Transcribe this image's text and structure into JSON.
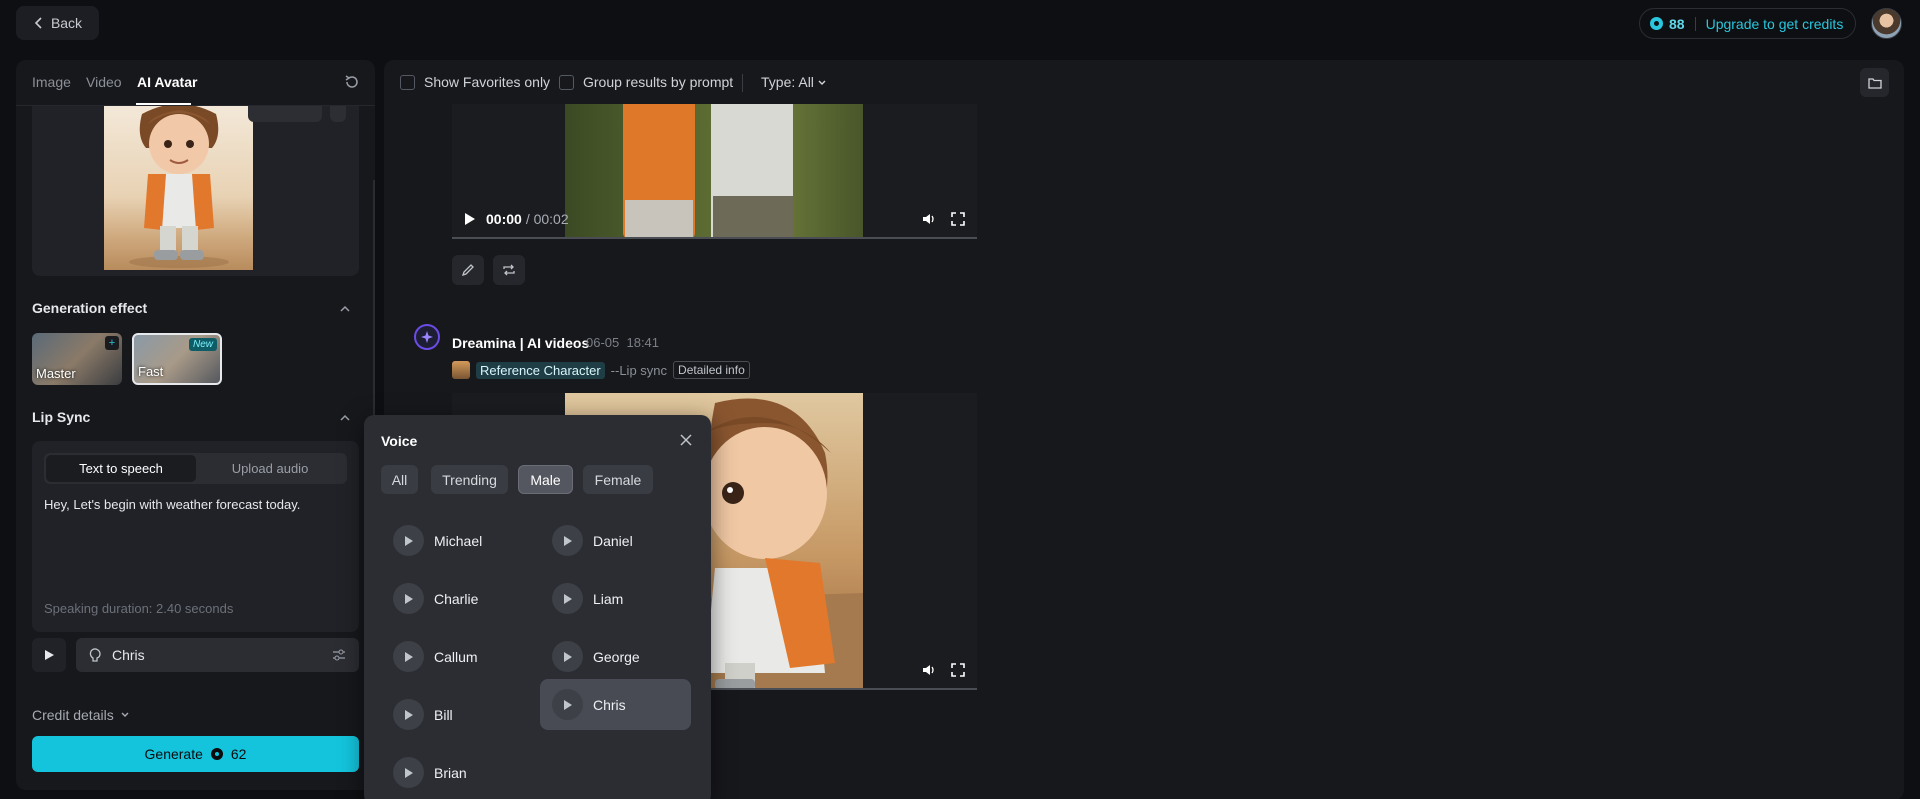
{
  "header": {
    "back_label": "Back",
    "credits": "88",
    "upgrade_label": "Upgrade to get credits"
  },
  "left": {
    "tabs": [
      {
        "label": "Image"
      },
      {
        "label": "Video"
      },
      {
        "label": "AI Avatar"
      }
    ],
    "generation_effect": {
      "title": "Generation effect",
      "options": [
        {
          "label": "Master",
          "badge": "+"
        },
        {
          "label": "Fast",
          "badge": "New"
        }
      ]
    },
    "lip_sync": {
      "title": "Lip Sync",
      "modes": [
        {
          "label": "Text to speech"
        },
        {
          "label": "Upload audio"
        }
      ],
      "speech_text": "Hey, Let's begin with weather forecast today.",
      "duration_text": "Speaking duration: 2.40 seconds"
    },
    "selected_voice": "Chris",
    "credit_details_label": "Credit details",
    "generate_label": "Generate",
    "generate_cost": "62"
  },
  "filters": {
    "favorites_label": "Show Favorites only",
    "group_label": "Group results by prompt",
    "type_label": "Type: All"
  },
  "video1": {
    "time_current": "00:00",
    "time_total": "/ 00:02"
  },
  "generation": {
    "title": "Dreamina | AI videos",
    "date": "06-05",
    "time": "18:41",
    "reference_label": "Reference Character",
    "mode_label": "--Lip sync",
    "detail_label": "Detailed info"
  },
  "voice_popup": {
    "title": "Voice",
    "tabs": [
      {
        "label": "All"
      },
      {
        "label": "Trending"
      },
      {
        "label": "Male"
      },
      {
        "label": "Female"
      }
    ],
    "voices": [
      {
        "name": "Michael"
      },
      {
        "name": "Daniel"
      },
      {
        "name": "Charlie"
      },
      {
        "name": "Liam"
      },
      {
        "name": "Callum"
      },
      {
        "name": "George"
      },
      {
        "name": "Bill"
      },
      {
        "name": "Chris"
      },
      {
        "name": "Brian"
      }
    ]
  },
  "colors": {
    "accent": "#14c4dd",
    "background": "#0e0f12",
    "panel": "#17181c"
  }
}
